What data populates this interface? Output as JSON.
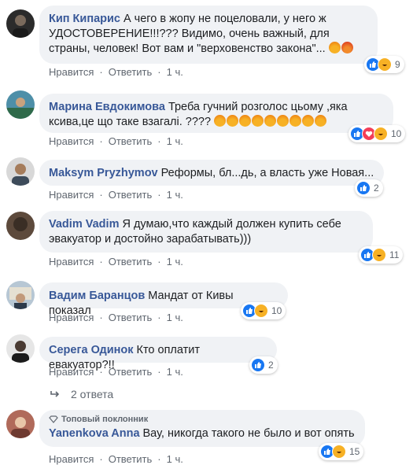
{
  "actions": {
    "like": "Нравится",
    "reply": "Ответить",
    "sep": "·",
    "time": "1 ч."
  },
  "comments": [
    {
      "author": "Кип Кипарис",
      "text": "А чего в жопу не поцеловали, у него ж УДОСТОВЕРЕНИЕ!!!??? Видимо, очень важный, для страны, человек! Вот вам и \"верховенство закона\"...",
      "reaction_count": "9"
    },
    {
      "author": "Марина Евдокимова",
      "text": "Треба гучний розголос цьому ,яка ксива,це що таке взагалі. ????",
      "reaction_count": "10"
    },
    {
      "author": "Maksym Pryzhymov",
      "text": "Реформы, бл...дь, а власть уже Новая...",
      "reaction_count": "2"
    },
    {
      "author": "Vadim Vadim",
      "text": "Я думаю,что каждый должен купить себе эвакуатор и достойно зарабатывать)))",
      "reaction_count": "11"
    },
    {
      "author": "Вадим Баранцов",
      "text": "Мандат от Кивы показал",
      "reaction_count": "10"
    },
    {
      "author": "Серега Одинок",
      "text": "Кто оплатит евакуатор?!!",
      "reaction_count": "2"
    },
    {
      "author": "Yanenkova Anna",
      "text": "Вау, никогда такого не было и вот опять",
      "reaction_count": "15",
      "badge": "Топовый поклонник"
    }
  ],
  "replies_label": "2 ответа",
  "colors": {
    "author": "#385898",
    "bubble": "#f0f2f5",
    "like": "#1877f2",
    "love": "#f33e58",
    "haha": "#f7b125"
  }
}
